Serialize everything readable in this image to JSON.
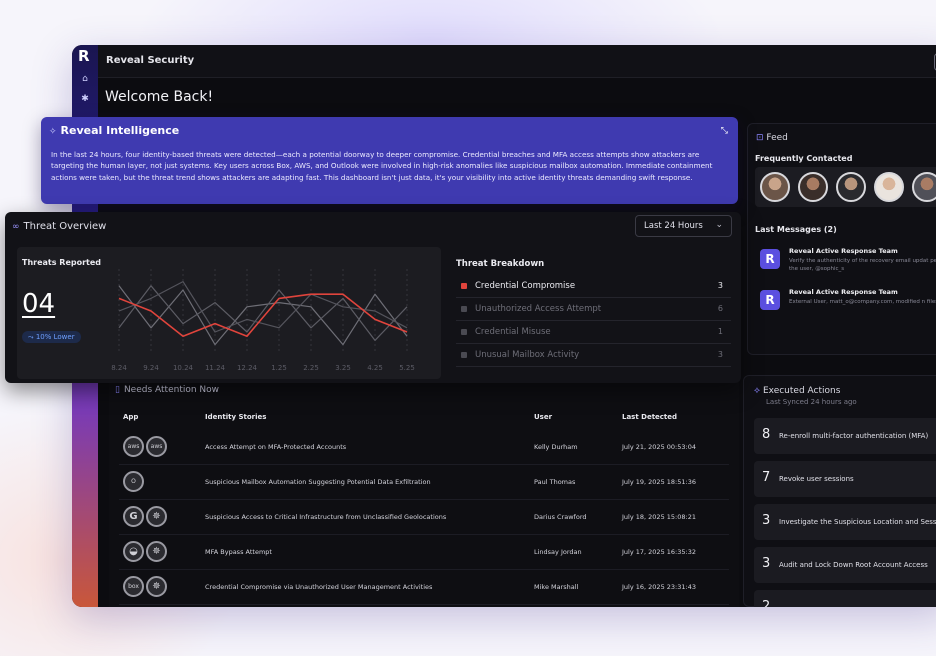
{
  "app": {
    "title": "Reveal Security",
    "welcome": "Welcome Back!"
  },
  "intelligence": {
    "title": "Reveal Intelligence",
    "body": "In the last 24 hours, four identity-based threats were detected—each a potential doorway to deeper compromise. Credential breaches and MFA access attempts show attackers are targeting the human layer, not just systems. Key users across Box, AWS, and Outlook were involved in high-risk anomalies like suspicious mailbox automation. Immediate containment actions were taken, but the threat trend shows attackers are adapting fast. This dashboard isn't just data, it's your visibility into active identity threats demanding swift response."
  },
  "threat_overview": {
    "title": "Threat Overview",
    "range": "Last 24 Hours",
    "reported_label": "Threats Reported",
    "count": "04",
    "trend": "10% Lower",
    "breakdown_title": "Threat Breakdown",
    "breakdown": [
      {
        "label": "Credential Compromise",
        "count": "3",
        "active": true
      },
      {
        "label": "Unauthorized Access Attempt",
        "count": "6",
        "active": false
      },
      {
        "label": "Credential Misuse",
        "count": "1",
        "active": false
      },
      {
        "label": "Unusual Mailbox Activity",
        "count": "3",
        "active": false
      }
    ]
  },
  "chart_data": {
    "type": "line",
    "x": [
      "8.24",
      "9.24",
      "10.24",
      "11.24",
      "12.24",
      "1.25",
      "2.25",
      "3.25",
      "4.25",
      "5.25"
    ],
    "ylim": [
      0,
      10
    ],
    "series": [
      {
        "color": "#e0443c",
        "highlight": true,
        "values": [
          6.5,
          5.0,
          2.0,
          3.5,
          2.0,
          6.5,
          7.0,
          7.0,
          4.0,
          2.5
        ]
      },
      {
        "color": "#6e6e76",
        "values": [
          8.0,
          3.0,
          7.5,
          1.0,
          5.5,
          6.0,
          5.5,
          1.0,
          7.0,
          2.0
        ]
      },
      {
        "color": "#5c5c64",
        "values": [
          3.0,
          8.0,
          3.5,
          6.0,
          2.5,
          7.5,
          3.0,
          6.5,
          1.5,
          5.5
        ]
      },
      {
        "color": "#54545c",
        "values": [
          5.0,
          6.5,
          8.5,
          2.5,
          4.0,
          3.0,
          7.0,
          5.5,
          5.0,
          3.0
        ]
      }
    ]
  },
  "feed": {
    "title": "Feed",
    "frequently_contacted": "Frequently Contacted",
    "last_messages": "Last Messages (2)",
    "messages": [
      {
        "title": "Reveal Active Response Team",
        "body": "Verify the authenticity of the recovery email updat performed by the user, @sophic_s"
      },
      {
        "title": "Reveal Active Response Team",
        "body": "External User, matt_o@company.com, modified n files"
      }
    ]
  },
  "needs_attention": {
    "title": "Needs Attention Now",
    "headers": {
      "app": "App",
      "story": "Identity Stories",
      "user": "User",
      "detected": "Last Detected"
    },
    "rows": [
      {
        "apps": [
          "aws",
          "aws"
        ],
        "story": "Access Attempt on MFA-Protected Accounts",
        "user": "Kelly Durham",
        "detected": "July 21, 2025 00:53:04"
      },
      {
        "apps": [
          "O"
        ],
        "story": "Suspicious Mailbox Automation Suggesting Potential Data Exfiltration",
        "user": "Paul Thomas",
        "detected": "July 19, 2025 18:51:36"
      },
      {
        "apps": [
          "G",
          "✵"
        ],
        "story": "Suspicious Access to Critical Infrastructure from Unclassified Geolocations",
        "user": "Darius Crawford",
        "detected": "July 18, 2025 15:08:21"
      },
      {
        "apps": [
          "◒",
          "✵"
        ],
        "story": "MFA Bypass Attempt",
        "user": "Lindsay Jordan",
        "detected": "July 17, 2025 16:35:32"
      },
      {
        "apps": [
          "box",
          "✵"
        ],
        "story": "Credential Compromise via Unauthorized User Management Activities",
        "user": "Mike Marshall",
        "detected": "July 16, 2025 23:31:43"
      }
    ]
  },
  "executed_actions": {
    "title": "Executed Actions",
    "last_synced": "Last Synced 24 hours ago",
    "items": [
      {
        "n": "8",
        "label": "Re-enroll multi-factor authentication (MFA)"
      },
      {
        "n": "7",
        "label": "Revoke user sessions"
      },
      {
        "n": "3",
        "label": "Investigate the Suspicious Location and Sessi"
      },
      {
        "n": "3",
        "label": "Audit and Lock Down Root Account Access"
      },
      {
        "n": "2",
        "label": ""
      }
    ]
  }
}
